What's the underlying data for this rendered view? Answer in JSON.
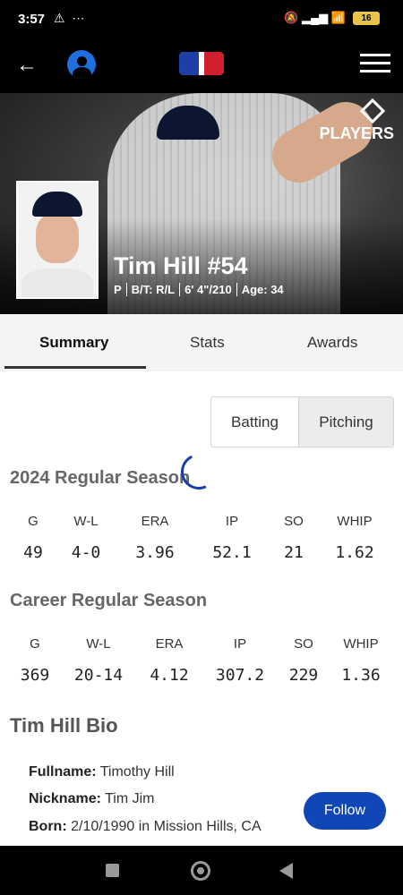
{
  "status_bar": {
    "time": "3:57",
    "left_icons": "⚠ ⋯",
    "right_icons": "🔕 ▂▄▆ 📶",
    "battery": "16"
  },
  "header": {
    "back_icon": "←"
  },
  "hero": {
    "badge": "PLAYERS",
    "name": "Tim Hill #54",
    "meta": [
      "P",
      "B/T: R/L",
      "6' 4\"/210",
      "Age: 34"
    ]
  },
  "tabs": [
    "Summary",
    "Stats",
    "Awards"
  ],
  "toggle": {
    "batting": "Batting",
    "pitching": "Pitching"
  },
  "season_2024": {
    "title": "2024 Regular Season",
    "headers": [
      "G",
      "W-L",
      "ERA",
      "IP",
      "SO",
      "WHIP"
    ],
    "values": [
      "49",
      "4-0",
      "3.96",
      "52.1",
      "21",
      "1.62"
    ]
  },
  "career": {
    "title": "Career Regular Season",
    "headers": [
      "G",
      "W-L",
      "ERA",
      "IP",
      "SO",
      "WHIP"
    ],
    "values": [
      "369",
      "20-14",
      "4.12",
      "307.2",
      "229",
      "1.36"
    ]
  },
  "bio": {
    "title": "Tim Hill Bio",
    "fullname_label": "Fullname:",
    "fullname": "Timothy Hill",
    "nickname_label": "Nickname:",
    "nickname": "Tim Jim",
    "born_label": "Born:",
    "born": "2/10/1990 in Mission Hills, CA"
  },
  "follow_label": "Follow"
}
